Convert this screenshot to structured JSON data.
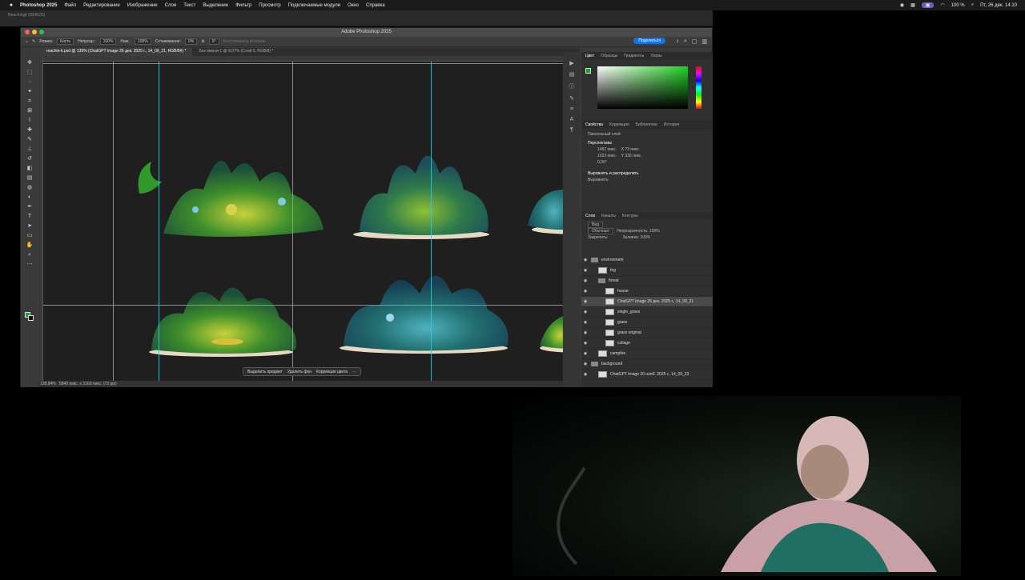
{
  "menubar": {
    "app_name": "Photoshop 2025",
    "items": [
      "Файл",
      "Редактирование",
      "Изображение",
      "Слои",
      "Текст",
      "Выделение",
      "Фильтр",
      "Просмотр",
      "Подключаемые модули",
      "Окно",
      "Справка"
    ],
    "battery": "100 %",
    "datetime": "Пт, 26 дек. 14:10"
  },
  "window": {
    "title": "Adobe Photoshop 2025",
    "share_label": "Поделиться"
  },
  "options": {
    "mode_label": "Режим:",
    "mode_value": "Кисть",
    "opacity_label": "Непрозр.:",
    "opacity_value": "100%",
    "flow_label": "Наж.:",
    "flow_value": "100%",
    "smoothing_label": "Сглаживание:",
    "smoothing_value": "0%",
    "angle_value": "0°",
    "history_label": "Восстановить историю"
  },
  "doc_tabs": [
    {
      "label": "reachin-it.psd @ 139% (ChatGPT Image 26 дек. 2025 г., 14_09_21, RGB/8#) *"
    },
    {
      "label": "Без имени-1 @ 8,07% (Слой 5, RGB/8) *"
    }
  ],
  "context_bar": {
    "select_subject": "Выделить предмет",
    "remove_bg": "Удалить фон",
    "color_correct": "Коррекция цвета"
  },
  "status": {
    "zoom": "138,84%",
    "size": "5840 пикс. x 2160 пикс. (72 ppi)"
  },
  "color_panel": {
    "tabs": [
      "Цвет",
      "Образцы",
      "Градиенты",
      "Узоры"
    ],
    "accent": "#1fd21f"
  },
  "properties": {
    "tabs": [
      "Свойства",
      "Коррекция",
      "Библиотеки",
      "История"
    ],
    "layer_type": "Пиксельный слой",
    "transform_title": "Перспектива",
    "w": "1482 пикс.",
    "x": "73 пикс.",
    "h": "1023 пикс.",
    "y": "336 пикс.",
    "angle": "0,00°",
    "align_title": "Выровнять и распределить",
    "align_label": "Выровнять:"
  },
  "layers": {
    "tabs": [
      "Слои",
      "Каналы",
      "Контуры"
    ],
    "filter_label": "Вид",
    "blend_mode": "Обычные",
    "opacity_label": "Непрозрачность:",
    "opacity_value": "100%",
    "lock_label": "Закрепить:",
    "fill_label": "Заливка:",
    "fill_value": "100%",
    "items": [
      {
        "name": "environment",
        "type": "group",
        "indent": 0
      },
      {
        "name": "fog",
        "type": "layer",
        "indent": 1
      },
      {
        "name": "forest",
        "type": "group",
        "indent": 1
      },
      {
        "name": "house",
        "type": "layer",
        "indent": 2
      },
      {
        "name": "ChatGPT Image 26 дек. 2025 г., 14_09_21",
        "type": "layer",
        "indent": 2,
        "selected": true
      },
      {
        "name": "single_grass",
        "type": "layer",
        "indent": 2
      },
      {
        "name": "grass",
        "type": "layer",
        "indent": 2
      },
      {
        "name": "grass original",
        "type": "layer",
        "indent": 2
      },
      {
        "name": "collage",
        "type": "layer",
        "indent": 2
      },
      {
        "name": "campfire",
        "type": "layer",
        "indent": 1
      },
      {
        "name": "background",
        "type": "group",
        "indent": 0
      },
      {
        "name": "ChatGPT Image 20 нояб. 2025 г., 14_09_23",
        "type": "layer",
        "indent": 1
      }
    ]
  },
  "bg_tabs": [
    "Reachingit (DEBUG)"
  ]
}
